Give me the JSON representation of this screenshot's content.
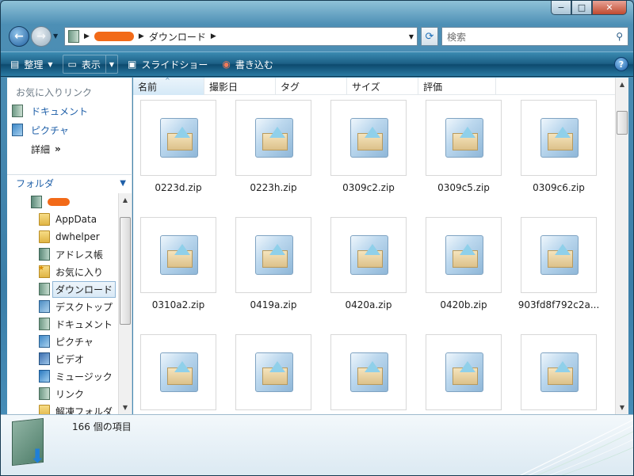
{
  "window": {
    "minimize_glyph": "−",
    "maximize_glyph": "□",
    "close_glyph": "✕"
  },
  "address": {
    "current_folder": "ダウンロード",
    "search_placeholder": "検索"
  },
  "toolbar": {
    "organize_label": "整理",
    "views_label": "表示",
    "slideshow_label": "スライドショー",
    "burn_label": "書き込む",
    "help_glyph": "?"
  },
  "favorites": {
    "header": "お気に入りリンク",
    "items": [
      {
        "label": "ドキュメント",
        "icon": "documents-icon"
      },
      {
        "label": "ピクチャ",
        "icon": "pictures-icon"
      }
    ],
    "more_label": "詳細",
    "more_glyph": "»"
  },
  "folders": {
    "header": "フォルダ",
    "tree": [
      {
        "label": "AppData",
        "icon": "folder-icon"
      },
      {
        "label": "dwhelper",
        "icon": "folder-icon"
      },
      {
        "label": "アドレス帳",
        "icon": "contacts-icon"
      },
      {
        "label": "お気に入り",
        "icon": "favorites-icon"
      },
      {
        "label": "ダウンロード",
        "icon": "downloads-icon"
      },
      {
        "label": "デスクトップ",
        "icon": "desktop-icon"
      },
      {
        "label": "ドキュメント",
        "icon": "documents-icon"
      },
      {
        "label": "ピクチャ",
        "icon": "pictures-icon"
      },
      {
        "label": "ビデオ",
        "icon": "videos-icon"
      },
      {
        "label": "ミュージック",
        "icon": "music-icon"
      },
      {
        "label": "リンク",
        "icon": "links-icon"
      },
      {
        "label": "解凍フォルダ",
        "icon": "folder-icon"
      }
    ]
  },
  "columns": [
    "名前",
    "撮影日",
    "タグ",
    "サイズ",
    "評価"
  ],
  "files": [
    "0223d.zip",
    "0223h.zip",
    "0309c2.zip",
    "0309c5.zip",
    "0309c6.zip",
    "0310a2.zip",
    "0419a.zip",
    "0420a.zip",
    "0420b.zip",
    "903fd8f792c2a...",
    "",
    "",
    "",
    "",
    ""
  ],
  "status": {
    "item_count": "166 個の項目"
  },
  "colors": {
    "toolbar": "#1c5f85",
    "link": "#1e5fa8",
    "redaction": "#f26a18"
  }
}
